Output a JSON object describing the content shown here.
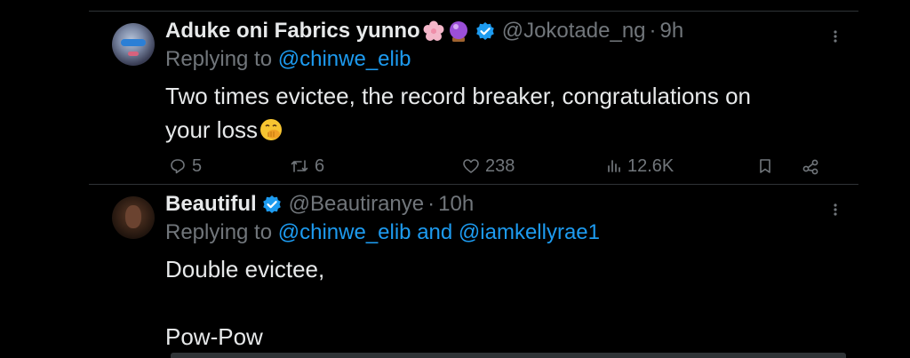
{
  "tweets": [
    {
      "name": "Aduke oni Fabrics yunno",
      "name_emojis": [
        "cherry-blossom-emoji",
        "crystal-ball-emoji"
      ],
      "verified": true,
      "handle": "@Jokotade_ng",
      "separator": "·",
      "time": "9h",
      "replying_prefix": "Replying to ",
      "replying_to": [
        "@chinwe_elib"
      ],
      "body_lines": [
        "Two times evictee, the record breaker, congratulations on",
        "your loss"
      ],
      "body_emoji": "face-with-hand-over-mouth-emoji",
      "actions": {
        "replies": "5",
        "retweets": "6",
        "likes": "238",
        "views": "12.6K"
      }
    },
    {
      "name": "Beautiful",
      "verified": true,
      "handle": "@Beautiranye",
      "separator": "·",
      "time": "10h",
      "replying_prefix": "Replying to ",
      "replying_to": [
        "@chinwe_elib",
        "@iamkellyrae1"
      ],
      "replying_joiner": " and ",
      "body_lines": [
        "Double evictee,",
        "",
        "Pow-Pow"
      ]
    }
  ],
  "colors": {
    "background": "#000000",
    "text": "#e7e9ea",
    "muted": "#71767b",
    "accent": "#1d9bf0",
    "divider": "#2f3336"
  }
}
